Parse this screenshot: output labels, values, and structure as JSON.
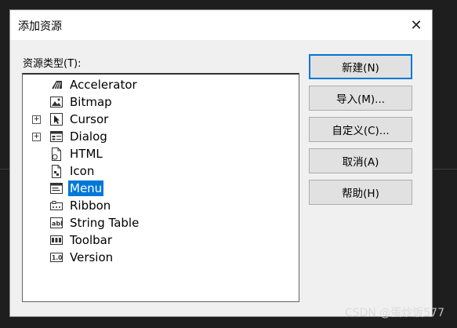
{
  "dialog": {
    "title": "添加资源",
    "close_glyph": "✕"
  },
  "resource_list": {
    "label": "资源类型(T):",
    "items": [
      {
        "label": "Accelerator",
        "icon": "accelerator-icon",
        "expandable": false,
        "selected": false
      },
      {
        "label": "Bitmap",
        "icon": "bitmap-icon",
        "expandable": false,
        "selected": false
      },
      {
        "label": "Cursor",
        "icon": "cursor-icon",
        "expandable": true,
        "selected": false
      },
      {
        "label": "Dialog",
        "icon": "dialog-icon",
        "expandable": true,
        "selected": false
      },
      {
        "label": "HTML",
        "icon": "html-file-icon",
        "expandable": false,
        "selected": false
      },
      {
        "label": "Icon",
        "icon": "icon-file-icon",
        "expandable": false,
        "selected": false
      },
      {
        "label": "Menu",
        "icon": "menu-icon",
        "expandable": false,
        "selected": true
      },
      {
        "label": "Ribbon",
        "icon": "ribbon-icon",
        "expandable": false,
        "selected": false
      },
      {
        "label": "String Table",
        "icon": "string-table-icon",
        "expandable": false,
        "selected": false
      },
      {
        "label": "Toolbar",
        "icon": "toolbar-icon",
        "expandable": false,
        "selected": false
      },
      {
        "label": "Version",
        "icon": "version-icon",
        "expandable": false,
        "selected": false
      }
    ],
    "expander_glyph": "+"
  },
  "buttons": {
    "new": "新建(N)",
    "import": "导入(M)...",
    "custom": "自定义(C)...",
    "cancel": "取消(A)",
    "help": "帮助(H)"
  },
  "watermark": "CSDN @蛋炒饭577",
  "colors": {
    "selection": "#0078d7",
    "dialog_bg": "#f0f0f0",
    "backdrop": "#1e1e1e"
  }
}
